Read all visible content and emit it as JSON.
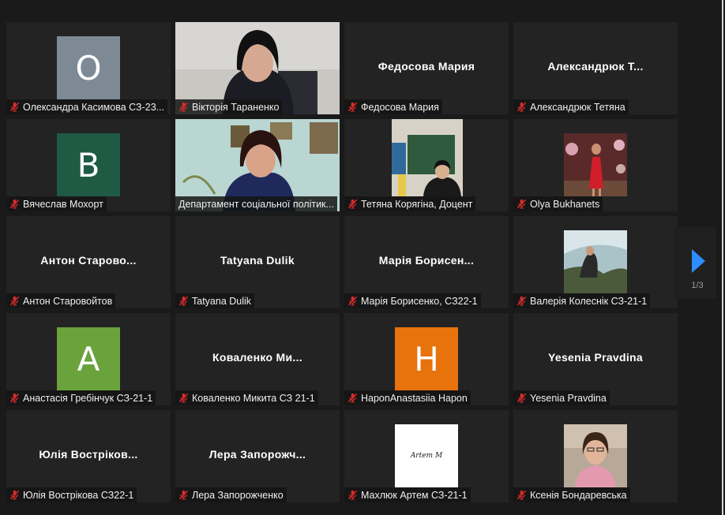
{
  "colors": {
    "background": "#1a1a1a",
    "tile": "#232323",
    "active_speaker_border": "#e6ef7a",
    "muted_mic": "#d92b2b",
    "nav_arrow": "#2d8cff"
  },
  "pagination": {
    "indicator": "1/3"
  },
  "tiles": [
    {
      "label": "Олександра Касимова СЗ-23...",
      "avatar_letter": "O",
      "avatar_color": "#7d8a96",
      "muted": true
    },
    {
      "label": "Вікторія Тараненко",
      "type": "video",
      "muted": true
    },
    {
      "label": "Федосова Мария",
      "big_name": "Федосова Мария",
      "muted": true
    },
    {
      "label": "Александрюк Тетяна",
      "big_name": "Александрюк  Т...",
      "muted": true
    },
    {
      "label": "Вячеслав Мохорт",
      "avatar_letter": "B",
      "avatar_color": "#1e5a44",
      "muted": true
    },
    {
      "label": "Департамент соціальної політик...",
      "type": "video",
      "active_speaker": true,
      "muted": false
    },
    {
      "label": "Тетяна Корягіна, Доцент",
      "type": "video",
      "muted": true
    },
    {
      "label": "Olya Bukhanets",
      "type": "photo",
      "muted": true
    },
    {
      "label": "Антон Старовойтов",
      "big_name": "Антон  Старово...",
      "muted": true
    },
    {
      "label": "Tatyana Dulik",
      "big_name": "Tatyana Dulik",
      "muted": true
    },
    {
      "label": "Марія Борисенко, СЗ22-1",
      "big_name": "Марія  Борисен...",
      "muted": true
    },
    {
      "label": "Валерія Колеснік СЗ-21-1",
      "type": "photo",
      "muted": true
    },
    {
      "label": "Анастасія Гребінчук СЗ-21-1",
      "avatar_letter": "A",
      "avatar_color": "#6aa23c",
      "muted": true
    },
    {
      "label": "Коваленко Микита СЗ 21-1",
      "big_name": "Коваленко  Ми...",
      "muted": true
    },
    {
      "label": "НaponAnastasiia Hapon",
      "avatar_letter": "H",
      "avatar_color": "#e8720c",
      "muted": true
    },
    {
      "label": "Yesenia Pravdina",
      "big_name": "Yesenia Pravdina",
      "muted": true
    },
    {
      "label": "Юлія Вострікова СЗ22-1",
      "big_name": "Юлія  Востріков...",
      "muted": true
    },
    {
      "label": "Лера Запорожченко",
      "big_name": "Лера  Запорожч...",
      "muted": true
    },
    {
      "label": "Махлюк Артем СЗ-21-1",
      "type": "photo",
      "photo_text": "Artem M",
      "muted": true
    },
    {
      "label": "Ксенія Бондаревська",
      "type": "photo",
      "muted": true
    }
  ]
}
